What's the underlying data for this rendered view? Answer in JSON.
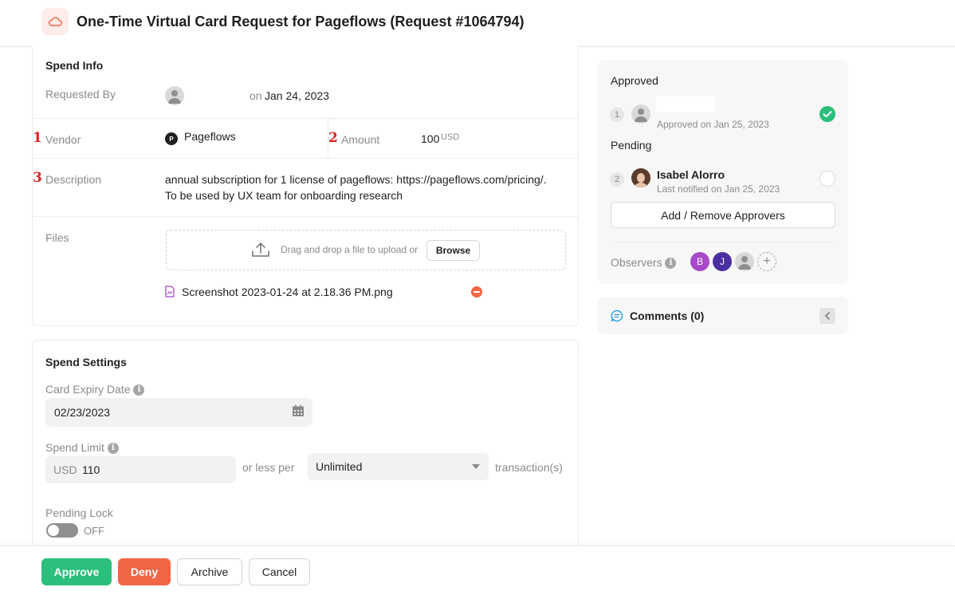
{
  "header": {
    "title": "One-Time Virtual Card Request for Pageflows (Request #1064794)",
    "icon": "cloud-icon",
    "icon_color": "#F26545"
  },
  "spend_info": {
    "title": "Spend Info",
    "requested_by_label": "Requested By",
    "requested_on_prefix": "on",
    "requested_on_date": "Jan 24, 2023",
    "vendor_marker": "1",
    "vendor_label": "Vendor",
    "vendor_logo_letter": "P",
    "vendor_value": "Pageflows",
    "amount_marker": "2",
    "amount_label": "Amount",
    "amount_value": "100",
    "amount_currency": "USD",
    "description_marker": "3",
    "description_label": "Description",
    "description_line1": "annual subscription for 1 license of pageflows: https://pageflows.com/pricing/.",
    "description_line2": "To be used by UX team for onboarding research",
    "files_label": "Files",
    "dropzone_text": "Drag and drop a file to upload or",
    "browse_label": "Browse",
    "file_name": "Screenshot 2023-01-24 at 2.18.36 PM.png"
  },
  "spend_settings": {
    "title": "Spend Settings",
    "card_expiry_label": "Card Expiry Date",
    "card_expiry_value": "02/23/2023",
    "spend_limit_label": "Spend Limit",
    "spend_limit_currency": "USD",
    "spend_limit_value": "110",
    "or_less_per": "or less per",
    "limit_period": "Unlimited",
    "transactions_suffix": "transaction(s)",
    "pending_lock_label": "Pending Lock",
    "pending_lock_state": "OFF"
  },
  "approvals": {
    "approved_heading": "Approved",
    "approver1_step": "1",
    "approver1_status": "Approved on Jan 25, 2023",
    "pending_heading": "Pending",
    "approver2_step": "2",
    "approver2_name": "Isabel Alorro",
    "approver2_status": "Last notified on Jan 25, 2023",
    "add_remove_label": "Add / Remove Approvers",
    "observers_label": "Observers",
    "observers": [
      {
        "initial": "B",
        "color": "#A64AC9"
      },
      {
        "initial": "J",
        "color": "#4A2FA0"
      }
    ]
  },
  "comments": {
    "label": "Comments (0)"
  },
  "footer": {
    "approve_label": "Approve",
    "deny_label": "Deny",
    "archive_label": "Archive",
    "cancel_label": "Cancel"
  },
  "colors": {
    "approve": "#2BBF7B",
    "deny": "#F26545",
    "marker": "#E02020"
  }
}
